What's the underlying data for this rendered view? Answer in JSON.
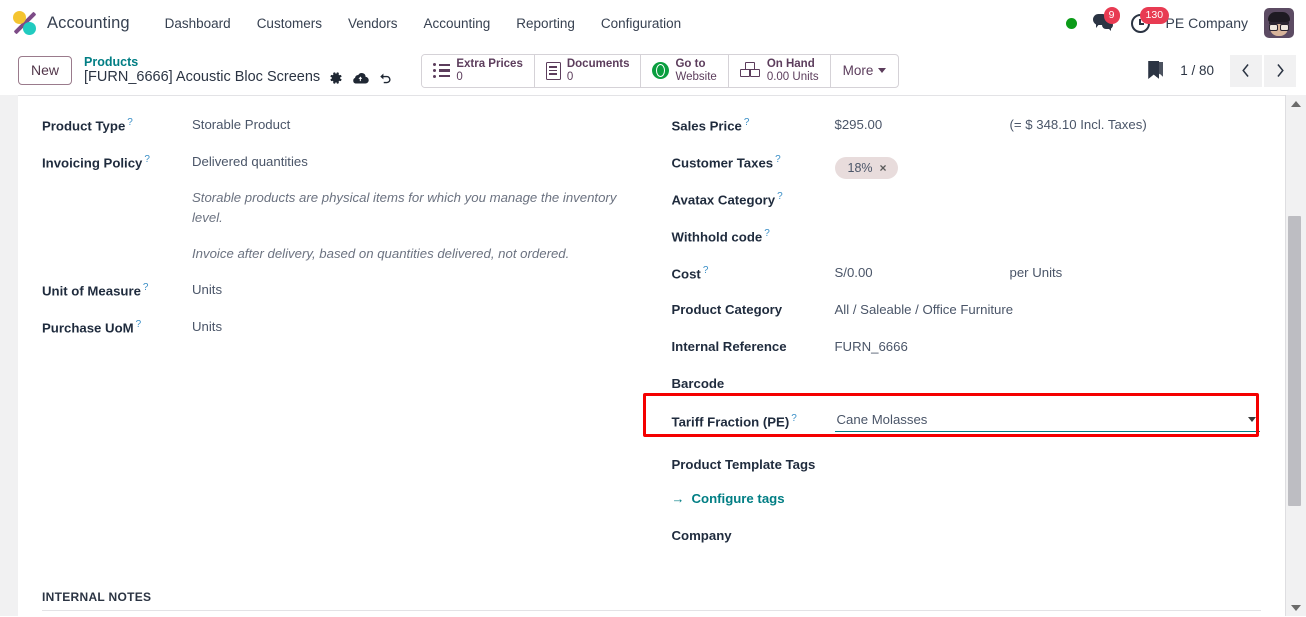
{
  "navbar": {
    "app_logo_icon": "accounting-app-logo",
    "app_name": "Accounting",
    "menus": [
      {
        "label": "Dashboard"
      },
      {
        "label": "Customers"
      },
      {
        "label": "Vendors"
      },
      {
        "label": "Accounting"
      },
      {
        "label": "Reporting"
      },
      {
        "label": "Configuration"
      }
    ],
    "status_indicator": "online-dot",
    "messages_icon": "chat-bubbles-icon",
    "messages_count": "9",
    "activities_icon": "clock-icon",
    "activities_count": "130",
    "company": "PE Company",
    "avatar_icon": "user-avatar"
  },
  "control_panel": {
    "new_label": "New",
    "breadcrumb_parent": "Products",
    "breadcrumb_current": "[FURN_6666] Acoustic Bloc Screens",
    "gear_icon": "gear-icon",
    "cloud_icon": "cloud-upload-icon",
    "undo_icon": "undo-icon",
    "smart_buttons": [
      {
        "icon": "list-icon",
        "label": "Extra Prices",
        "value": "0"
      },
      {
        "icon": "document-icon",
        "label": "Documents",
        "value": "0"
      },
      {
        "icon": "globe-icon",
        "label": "Go to",
        "value": "Website"
      },
      {
        "icon": "boxes-icon",
        "label": "On Hand",
        "value": "0.00 Units"
      }
    ],
    "more_label": "More",
    "bookmark_icon": "bookmark-icon",
    "pager": "1 / 80",
    "prev_icon": "chevron-left-icon",
    "next_icon": "chevron-right-icon"
  },
  "form": {
    "left": {
      "product_type_label": "Product Type",
      "product_type_value": "Storable Product",
      "invoicing_policy_label": "Invoicing Policy",
      "invoicing_policy_value": "Delivered quantities",
      "note_storable": "Storable products are physical items for which you manage the inventory level.",
      "note_invoice": "Invoice after delivery, based on quantities delivered, not ordered.",
      "uom_label": "Unit of Measure",
      "uom_value": "Units",
      "purchase_uom_label": "Purchase UoM",
      "purchase_uom_value": "Units"
    },
    "right": {
      "sales_price_label": "Sales Price",
      "sales_price_value": "$295.00",
      "sales_price_incl": "(= $ 348.10 Incl. Taxes)",
      "customer_taxes_label": "Customer Taxes",
      "customer_taxes_tag": "18%",
      "customer_taxes_tag_remove": "×",
      "avatax_label": "Avatax Category",
      "avatax_value": "",
      "withhold_label": "Withhold code",
      "withhold_value": "",
      "cost_label": "Cost",
      "cost_value": "S/0.00",
      "cost_unit": "per Units",
      "product_category_label": "Product Category",
      "product_category_value": "All / Saleable / Office Furniture",
      "internal_reference_label": "Internal Reference",
      "internal_reference_value": "FURN_6666",
      "barcode_label": "Barcode",
      "barcode_value": "",
      "tariff_label": "Tariff Fraction (PE)",
      "tariff_value": "Cane Molasses",
      "tariff_caret_icon": "chevron-down-icon",
      "template_tags_label": "Product Template Tags",
      "configure_tags_label": "Configure tags",
      "configure_tags_arrow": "→",
      "company_label": "Company",
      "company_value": ""
    },
    "section_internal_notes": "INTERNAL NOTES",
    "help_marker": "?"
  },
  "colors": {
    "highlight_border": "#f40000",
    "accent_teal": "#017e84",
    "badge_red": "#e83b52",
    "status_green": "#0b9b18",
    "smart_button_text": "#5c3d5c"
  }
}
